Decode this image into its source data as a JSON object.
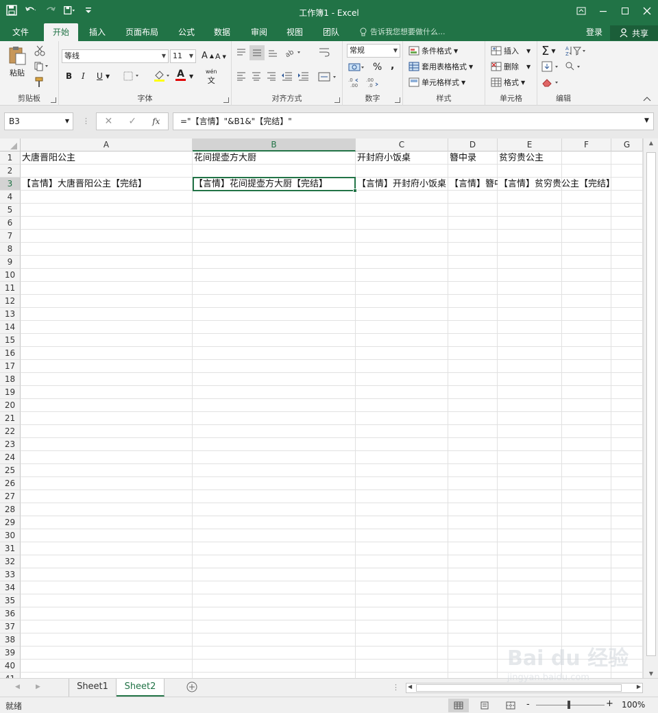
{
  "window": {
    "title": "工作簿1 - Excel",
    "quick_access": [
      "save-icon",
      "undo-icon",
      "redo-icon",
      "quick-print-icon",
      "customize-icon"
    ]
  },
  "ribbon_tabs": {
    "file": "文件",
    "home": "开始",
    "insert": "插入",
    "page_layout": "页面布局",
    "formulas": "公式",
    "data": "数据",
    "review": "审阅",
    "view": "视图",
    "team": "团队",
    "tell_me": "告诉我您想要做什么...",
    "login": "登录",
    "share": "共享"
  },
  "ribbon": {
    "clipboard": {
      "label": "剪贴板",
      "paste": "粘贴"
    },
    "font": {
      "label": "字体",
      "font_name": "等线",
      "font_size": "11",
      "bold": "B",
      "italic": "I",
      "underline": "U",
      "grow": "A",
      "shrink": "A",
      "font_color_char": "A",
      "phonetic": "wén"
    },
    "alignment": {
      "label": "对齐方式"
    },
    "number": {
      "label": "数字",
      "format": "常规",
      "percent": "%",
      "comma": ","
    },
    "styles": {
      "label": "样式",
      "conditional": "条件格式",
      "table": "套用表格格式",
      "cell_styles": "单元格样式"
    },
    "cells": {
      "label": "单元格",
      "insert": "插入",
      "delete": "删除",
      "format": "格式"
    },
    "editing": {
      "label": "编辑",
      "sigma": "Σ"
    }
  },
  "formula_bar": {
    "name_box": "B3",
    "fx": "fx",
    "formula": "=\"【言情】\"&B1&\"【完结】\""
  },
  "columns": [
    "A",
    "B",
    "C",
    "D",
    "E",
    "F",
    "G"
  ],
  "selected_column": "B",
  "rows": [
    "1",
    "2",
    "3",
    "4",
    "5",
    "6",
    "7",
    "8",
    "9",
    "10",
    "11",
    "12",
    "13",
    "14",
    "15",
    "16",
    "17",
    "18",
    "19",
    "20",
    "21",
    "22",
    "23",
    "24",
    "25",
    "26",
    "27",
    "28",
    "29",
    "30",
    "31",
    "32",
    "33",
    "34",
    "35",
    "36",
    "37",
    "38",
    "39",
    "40",
    "41"
  ],
  "cells": {
    "A1": "大唐晋阳公主",
    "B1": "花间提壶方大厨",
    "C1": "开封府小饭桌",
    "D1": "簪中录",
    "E1": "贫穷贵公主",
    "A3": "【言情】大唐晋阳公主【完结】",
    "B3": "【言情】花间提壶方大厨【完结】",
    "C3": "【言情】开封府小饭桌【完结】",
    "D3": "【言情】簪中录【完结】",
    "E3": "【言情】贫穷贵公主【完结】"
  },
  "sheets": [
    "Sheet1",
    "Sheet2"
  ],
  "active_sheet": "Sheet2",
  "status": {
    "ready": "就绪",
    "zoom": "100%",
    "zoom_minus": "-",
    "zoom_plus": "+"
  },
  "watermark": {
    "brand": "Bai du 经验",
    "url": "jingyan.baidu.com"
  }
}
